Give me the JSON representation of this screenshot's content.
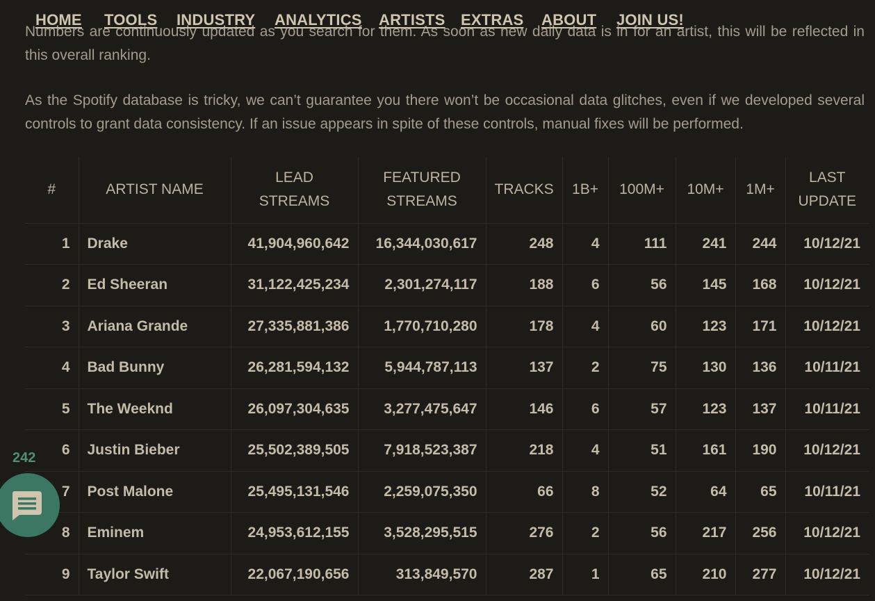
{
  "nav": {
    "items": [
      "HOME",
      "TOOLS",
      "INDUSTRY",
      "ANALYTICS",
      "ARTISTS",
      "EXTRAS",
      "ABOUT",
      "JOIN US!"
    ]
  },
  "intro": {
    "p1": "Numbers are continuously updated as you search for them. As soon as new daily data is in for an artist, this will be reflected in this overall ranking.",
    "p2": "As the Spotify database is tricky, we can’t guarantee you there won’t be occasional data glitches, even if we developed several controls to grant data consistency. If an issue appears in spite of these controls, manual fixes will be performed."
  },
  "table": {
    "headers": [
      {
        "line1": "#",
        "line2": ""
      },
      {
        "line1": "ARTIST NAME",
        "line2": ""
      },
      {
        "line1": "LEAD",
        "line2": "STREAMS"
      },
      {
        "line1": "FEATURED",
        "line2": "STREAMS"
      },
      {
        "line1": "TRACKS",
        "line2": ""
      },
      {
        "line1": "1B+",
        "line2": ""
      },
      {
        "line1": "100M+",
        "line2": ""
      },
      {
        "line1": "10M+",
        "line2": ""
      },
      {
        "line1": "1M+",
        "line2": ""
      },
      {
        "line1": "LAST",
        "line2": "UPDATE"
      }
    ],
    "rows": [
      [
        "1",
        "Drake",
        "41,904,960,642",
        "16,344,030,617",
        "248",
        "4",
        "111",
        "241",
        "244",
        "10/12/21"
      ],
      [
        "2",
        "Ed Sheeran",
        "31,122,425,234",
        "2,301,274,117",
        "188",
        "6",
        "56",
        "145",
        "168",
        "10/12/21"
      ],
      [
        "3",
        "Ariana Grande",
        "27,335,881,386",
        "1,770,710,280",
        "178",
        "4",
        "60",
        "123",
        "171",
        "10/12/21"
      ],
      [
        "4",
        "Bad Bunny",
        "26,281,594,132",
        "5,944,787,113",
        "137",
        "2",
        "75",
        "130",
        "136",
        "10/11/21"
      ],
      [
        "5",
        "The Weeknd",
        "26,097,304,635",
        "3,277,475,647",
        "146",
        "6",
        "57",
        "123",
        "137",
        "10/11/21"
      ],
      [
        "6",
        "Justin Bieber",
        "25,502,389,505",
        "7,918,523,387",
        "218",
        "4",
        "51",
        "161",
        "190",
        "10/12/21"
      ],
      [
        "7",
        "Post Malone",
        "25,495,131,546",
        "2,259,075,350",
        "66",
        "8",
        "52",
        "64",
        "65",
        "10/11/21"
      ],
      [
        "8",
        "Eminem",
        "24,953,612,155",
        "3,528,295,515",
        "276",
        "2",
        "56",
        "217",
        "256",
        "10/12/21"
      ],
      [
        "9",
        "Taylor Swift",
        "22,067,190,656",
        "313,849,570",
        "287",
        "1",
        "65",
        "210",
        "277",
        "10/12/21"
      ]
    ]
  },
  "chat": {
    "count": "242",
    "icon": "chat-bubble-icon"
  },
  "colors": {
    "background": "#1c1b18",
    "text": "#c4bba8",
    "accent": "#3b7762"
  }
}
